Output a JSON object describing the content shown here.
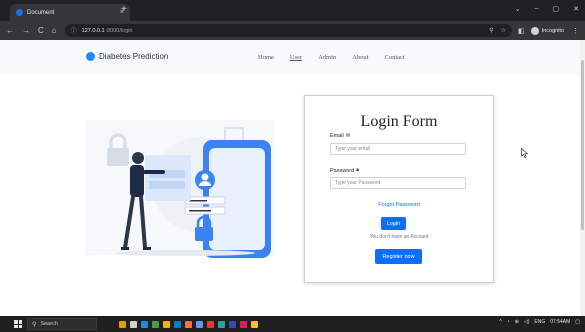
{
  "browser": {
    "tab_title": "Document",
    "tab_close": "×",
    "new_tab": "+",
    "window_controls": [
      "⌄",
      "–",
      "▢",
      "✕"
    ],
    "nav_icons": [
      "←",
      "→",
      "C",
      "⌂"
    ],
    "url_host": "127.0.0.1",
    "url_path": ":8000/login",
    "omni_icons": [
      "⚲",
      "☆"
    ],
    "incognito_label": "Incognito",
    "menu": "⋮"
  },
  "site": {
    "brand": "Diabetes Prediction",
    "nav": [
      "Home",
      "User",
      "Admin",
      "About",
      "Contact"
    ],
    "active_nav": "User"
  },
  "login": {
    "title": "Login Form",
    "email_label": "Email",
    "email_icon": "envelope-icon",
    "email_placeholder": "Type your email",
    "password_label": "Password",
    "password_icon": "lock-icon",
    "password_placeholder": "Type your Password",
    "forgot": "Forgot Password",
    "login_button": "Login",
    "no_account": "You don't have an Account",
    "register_button": "Register now"
  },
  "taskbar": {
    "search": "Search",
    "tray": [
      "^",
      "◔",
      "⊕",
      "◁)",
      "ENG",
      "07:54AM",
      "▢"
    ]
  },
  "colors": {
    "primary": "#0d6efd",
    "brand_logo": "#1a8cff",
    "illustration_blue": "#3b82f6",
    "chrome_dark": "#202124"
  }
}
